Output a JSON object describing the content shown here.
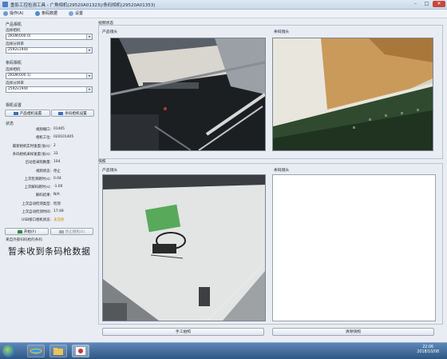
{
  "window": {
    "title": "重影工控检测工具 - 广角相机(29520A01323)/条码相机(29520A01353)",
    "buttons": {
      "min": "–",
      "max": "□",
      "close": "✕"
    }
  },
  "menu": [
    {
      "label": "操作(A)"
    },
    {
      "label": "条码数据"
    },
    {
      "label": "设置"
    }
  ],
  "left": {
    "product_cam_label": "产品相机",
    "product_select_label": "选择相机",
    "product_select_value": "ZKSM(000 0)",
    "product_res_label": "选择分辨率",
    "product_res_value": "2592x1944",
    "barcode_cam_label": "条码相机",
    "barcode_select_label": "选择相机",
    "barcode_select_value": "ZKSM(000 1)",
    "barcode_res_label": "选择分辨率",
    "barcode_res_value": "2592x1944",
    "settings_label": "相机设置",
    "product_settings_btn": "产品相机设置",
    "barcode_settings_btn": "条码相机设置",
    "status_title": "状态",
    "status_rows": [
      {
        "k": "视频端口:",
        "v": "01405"
      },
      {
        "k": "相机工位:",
        "v": "020101405"
      },
      {
        "k": "最新相机实时速度(张/s):",
        "v": "2"
      },
      {
        "k": "条码相机采样速度(张/s):",
        "v": "33"
      },
      {
        "k": "启动后采购数量:",
        "v": "104"
      },
      {
        "k": "视频状态:",
        "v": "停止"
      },
      {
        "k": "上次检测耗时(s):",
        "v": "0.04"
      },
      {
        "k": "上次解码耗时(s):",
        "v": "-1.00"
      },
      {
        "k": "解码结果:",
        "v": "N/A"
      },
      {
        "k": "上次自动检测类型:",
        "v": "检测"
      },
      {
        "k": "上次自动检测时间:",
        "v": "17:49"
      },
      {
        "k": "USB接口相机状态:",
        "v": "未连接"
      }
    ],
    "start_btn": "开始(F)",
    "stop_btn": "停止相机(E)",
    "hint": "来自外部扫码枪的条码",
    "big_msg": "暂未收到条码枪数据"
  },
  "main": {
    "video_group": "视频状态",
    "prod_cam_label_top": "产品镜头",
    "barcode_cam_label_top": "条码镜头",
    "capture_group": "快照",
    "prod_cam_label_bottom": "产品镜头",
    "barcode_cam_label_bottom": "条码镜头",
    "manual_capture_btn": "手工拍照",
    "clear_capture_btn": "清除快照"
  },
  "taskbar": {
    "time": "22:06",
    "date": "2018/10/08"
  },
  "colors": {
    "status_unconnected": "#d28a00",
    "titlebar_bg": "#c9d8ea",
    "taskbar_bg": "#2f5784"
  }
}
